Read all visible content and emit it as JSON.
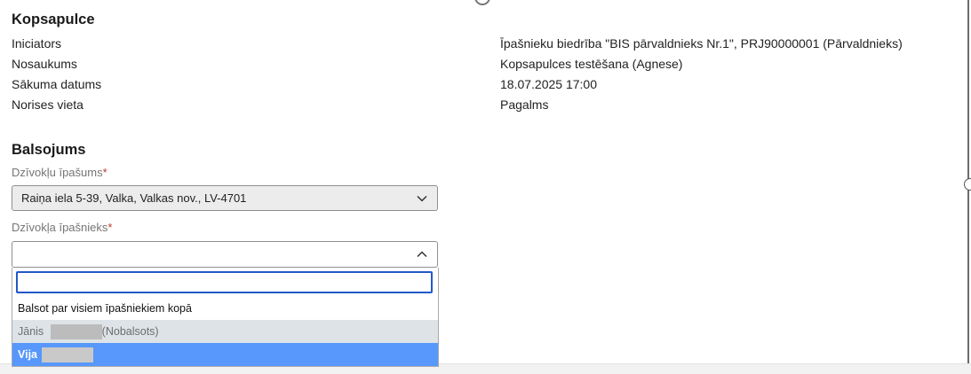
{
  "meeting": {
    "title": "Kopsapulce",
    "rows": [
      {
        "label": "Iniciators",
        "value": "Īpašnieku biedrība \"BIS pārvaldnieks Nr.1\", PRJ90000001 (Pārvaldnieks)"
      },
      {
        "label": "Nosaukums",
        "value": "Kopsapulces testēšana (Agnese)"
      },
      {
        "label": "Sākuma datums",
        "value": "18.07.2025 17:00"
      },
      {
        "label": "Norises vieta",
        "value": "Pagalms"
      }
    ]
  },
  "voting": {
    "title": "Balsojums",
    "property_label": "Dzīvokļu īpašums",
    "property_value": "Raiņa iela 5-39, Valka, Valkas nov., LV-4701",
    "owner_label": "Dzīvokļa īpašnieks",
    "required_mark": "*",
    "owner_value": "",
    "search_value": "",
    "options": [
      {
        "prefix": "Balsot par visiem īpašniekiem kopā",
        "suffix": "",
        "state": "normal"
      },
      {
        "prefix": "Jānis",
        "suffix": "(Nobalsots)",
        "state": "disabled"
      },
      {
        "prefix": "Vija",
        "suffix": "",
        "state": "selected"
      }
    ]
  },
  "icons": {
    "property_select": "chevron-down-icon",
    "owner_select": "chevron-up-icon"
  },
  "colors": {
    "selected": "#5897fb",
    "focus_border": "#2358c8",
    "required": "#c0392b"
  }
}
